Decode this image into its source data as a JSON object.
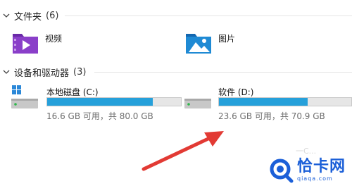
{
  "sections": {
    "folders": {
      "title": "文件夹",
      "count": "(6)"
    },
    "devices": {
      "title": "设备和驱动器",
      "count": "(3)"
    }
  },
  "folders": [
    {
      "label": "视频",
      "icon": "video-folder-icon",
      "color": "#8a3fc9"
    },
    {
      "label": "图片",
      "icon": "pictures-folder-icon",
      "color": "#1f8ad4"
    }
  ],
  "drives": [
    {
      "name": "本地磁盘 (C:)",
      "free_text": "16.6 GB 可用，共 80.0 GB",
      "used_fraction": 0.79,
      "icon": "windows-drive-icon"
    },
    {
      "name": "软件 (D:)",
      "free_text": "23.6 GB 可用，共 70.9 GB",
      "used_fraction": 0.67,
      "icon": "hard-drive-icon"
    }
  ],
  "watermark": {
    "text": "恰卡网",
    "sub": "qiaqa.com"
  },
  "faint_text": "一C...",
  "colors": {
    "bar_fill": "#26a0da",
    "bar_track": "#e6e6e6",
    "arrow": "#e23a34",
    "watermark": "#1b5fd8"
  }
}
